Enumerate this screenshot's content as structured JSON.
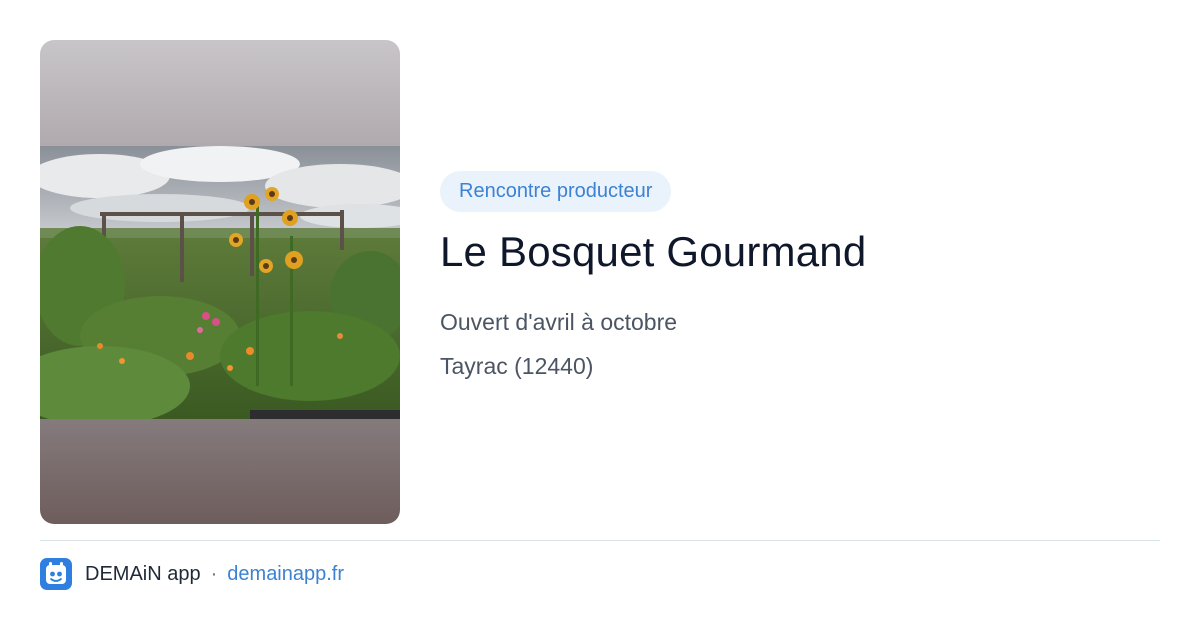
{
  "preview": {
    "image": {
      "description": "photo of a flower garden with sunflowers",
      "gradient_top": "#c8c5c8",
      "gradient_bottom": "#6e5d5c"
    },
    "tag": "Rencontre producteur",
    "title": "Le Bosquet Gourmand",
    "opening": "Ouvert d'avril à octobre",
    "location": "Tayrac (12440)"
  },
  "footer": {
    "logo_icon": "demain-app-logo-icon",
    "app_name": "DEMAiN app",
    "separator": "·",
    "link_text": "demainapp.fr"
  },
  "colors": {
    "accent": "#3c82d3",
    "tag_background": "#eaf2fb",
    "title": "#0f172a",
    "text": "#4b5563",
    "divider": "#d8e3ea"
  }
}
